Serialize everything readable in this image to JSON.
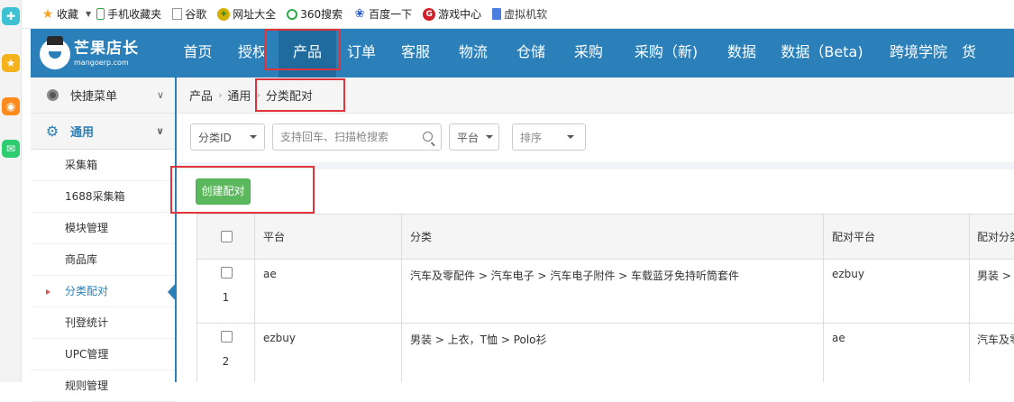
{
  "bookmarks": [
    {
      "label": "收藏",
      "icon": "star-icon"
    },
    {
      "label": "手机收藏夹",
      "icon": "phone-icon"
    },
    {
      "label": "谷歌",
      "icon": "page-icon"
    },
    {
      "label": "网址大全",
      "icon": "plus-globe-icon"
    },
    {
      "label": "360搜索",
      "icon": "360-icon"
    },
    {
      "label": "百度一下",
      "icon": "paw-icon"
    },
    {
      "label": "游戏中心",
      "icon": "game-icon"
    },
    {
      "label": "虚拟机软",
      "icon": "doc-icon"
    }
  ],
  "browser_sidebar": [
    "add-icon",
    "star-icon",
    "weibo-icon",
    "mail-icon"
  ],
  "logo": {
    "cn": "芒果店长",
    "en": "mangoerp.com"
  },
  "nav": [
    "首页",
    "授权",
    "产品",
    "订单",
    "客服",
    "物流",
    "仓储",
    "采购",
    "采购（新)",
    "数据",
    "数据（Beta)",
    "跨境学院",
    "货"
  ],
  "nav_active": "产品",
  "sidebar": {
    "quick_menu": "快捷菜单",
    "general": "通用",
    "items": [
      "采集箱",
      "1688采集箱",
      "模块管理",
      "商品库",
      "分类配对",
      "刊登统计",
      "UPC管理",
      "规则管理"
    ],
    "active_item": "分类配对"
  },
  "breadcrumb": [
    "产品",
    "通用",
    "分类配对"
  ],
  "filters": {
    "category_id": "分类ID",
    "search_placeholder": "支持回车、扫描枪搜索",
    "platform": "平台",
    "sort": "排序"
  },
  "create_button": "创建配对",
  "table": {
    "headers": [
      "平台",
      "分类",
      "配对平台",
      "配对分类"
    ],
    "rows": [
      {
        "index": "1",
        "platform": "ae",
        "category": "汽车及零配件 > 汽车电子 > 汽车电子附件 > 车载蓝牙免持听筒套件",
        "match_platform": "ezbuy",
        "match_category": "男装 > 外"
      },
      {
        "index": "2",
        "platform": "ezbuy",
        "category": "男装 > 上衣，T恤 > Polo衫",
        "match_platform": "ae",
        "match_category": "汽车及零"
      }
    ]
  },
  "colors": {
    "header": "#2b80b9",
    "active_nav": "#1f6b9e",
    "create": "#5cb85c",
    "highlight": "#e0343a"
  }
}
